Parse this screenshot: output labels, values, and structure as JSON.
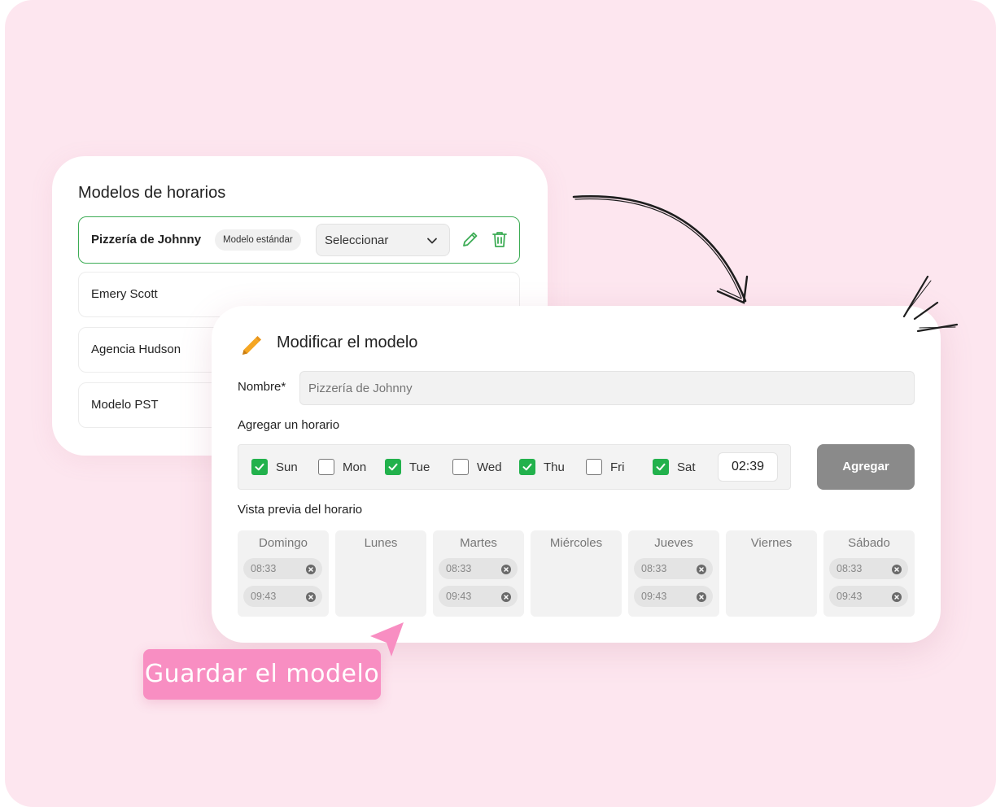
{
  "colors": {
    "background": "#fde6ef",
    "accent_green": "#22b14c",
    "accent_pink": "#f88ec2",
    "pencil_orange": "#f5a623"
  },
  "models": {
    "title": "Modelos de horarios",
    "selected": {
      "name": "Pizzería de Johnny",
      "badge": "Modelo estándar",
      "select_value": "Seleccionar"
    },
    "items": [
      {
        "name": "Emery Scott"
      },
      {
        "name": "Agencia Hudson"
      },
      {
        "name": "Modelo PST"
      }
    ]
  },
  "edit": {
    "title": "Modificar el modelo",
    "name_label": "Nombre*",
    "name_placeholder": "Pizzería de Johnny",
    "add_schedule_label": "Agregar un horario",
    "days": [
      {
        "label": "Sun",
        "checked": true
      },
      {
        "label": "Mon",
        "checked": false
      },
      {
        "label": "Tue",
        "checked": true
      },
      {
        "label": "Wed",
        "checked": false
      },
      {
        "label": "Thu",
        "checked": true
      },
      {
        "label": "Fri",
        "checked": false
      },
      {
        "label": "Sat",
        "checked": true
      }
    ],
    "time": "02:39",
    "add_button": "Agregar",
    "preview_label": "Vista previa del horario",
    "columns": [
      {
        "name": "Domingo",
        "times": [
          "08:33",
          "09:43"
        ]
      },
      {
        "name": "Lunes",
        "times": []
      },
      {
        "name": "Martes",
        "times": [
          "08:33",
          "09:43"
        ]
      },
      {
        "name": "Miércoles",
        "times": []
      },
      {
        "name": "Jueves",
        "times": [
          "08:33",
          "09:43"
        ]
      },
      {
        "name": "Viernes",
        "times": []
      },
      {
        "name": "Sábado",
        "times": [
          "08:33",
          "09:43"
        ]
      }
    ]
  },
  "callout": {
    "text": "Guardar el modelo"
  }
}
